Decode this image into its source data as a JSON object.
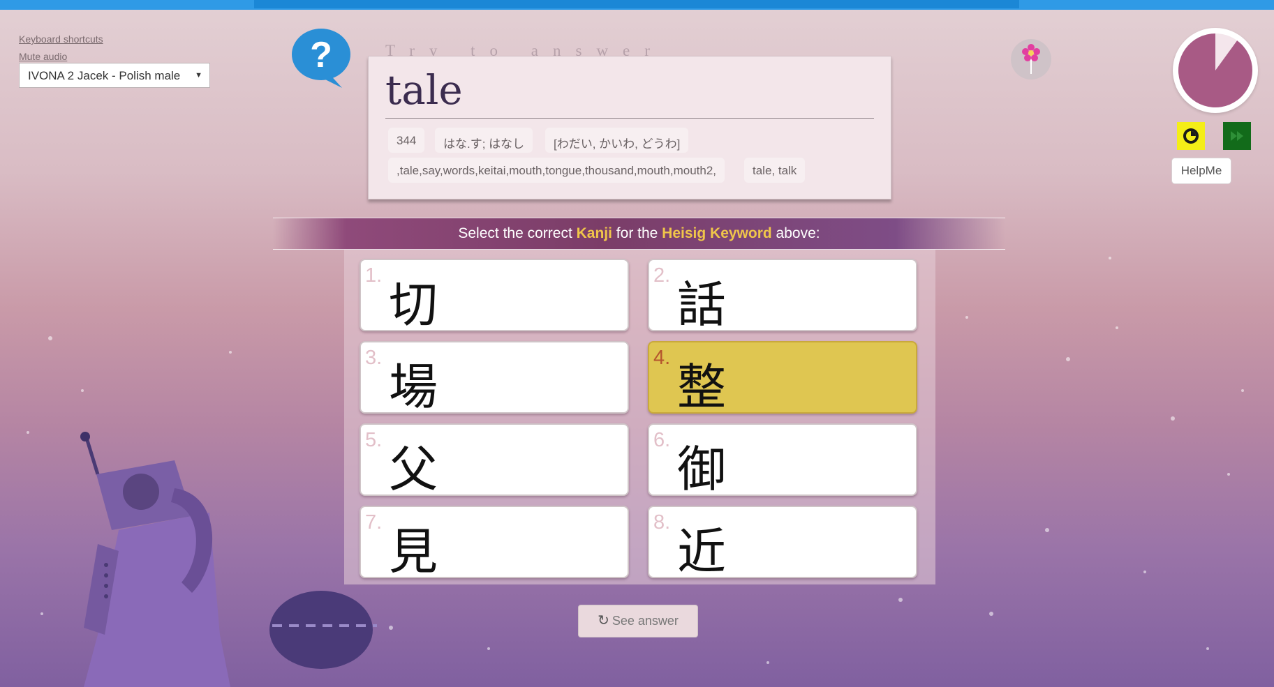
{
  "top_links": {
    "keyboard_shortcuts": "Keyboard shortcuts",
    "mute_audio": "Mute audio"
  },
  "voice": {
    "selected": "IVONA 2 Jacek - Polish male"
  },
  "prompt": {
    "try_to_answer": "Try to answer",
    "keyword": "tale",
    "chips": [
      "344",
      "はな.す; はなし",
      "[わだい, かいわ, どうわ]",
      ",tale,say,words,keitai,mouth,tongue,thousand,mouth,mouth2,",
      "tale, talk"
    ]
  },
  "timer": {
    "remaining_fraction": 0.9
  },
  "controls": {
    "helpme_label": "HelpMe"
  },
  "instruction": {
    "before": "Select the correct ",
    "kanji_word": "Kanji",
    "middle": " for the ",
    "keyword_word": "Heisig Keyword",
    "after": " above:"
  },
  "choices": [
    {
      "num": "1.",
      "kanji": "切"
    },
    {
      "num": "2.",
      "kanji": "話"
    },
    {
      "num": "3.",
      "kanji": "場"
    },
    {
      "num": "4.",
      "kanji": "整"
    },
    {
      "num": "5.",
      "kanji": "父"
    },
    {
      "num": "6.",
      "kanji": "御"
    },
    {
      "num": "7.",
      "kanji": "見"
    },
    {
      "num": "8.",
      "kanji": "近"
    }
  ],
  "selected_choice": 4,
  "see_answer_label": "See answer",
  "colors": {
    "highlight": "#f0c64a",
    "selected_choice": "#dfc651",
    "timer_fill": "#a85a85",
    "top_bar": "#2f9ae6"
  }
}
